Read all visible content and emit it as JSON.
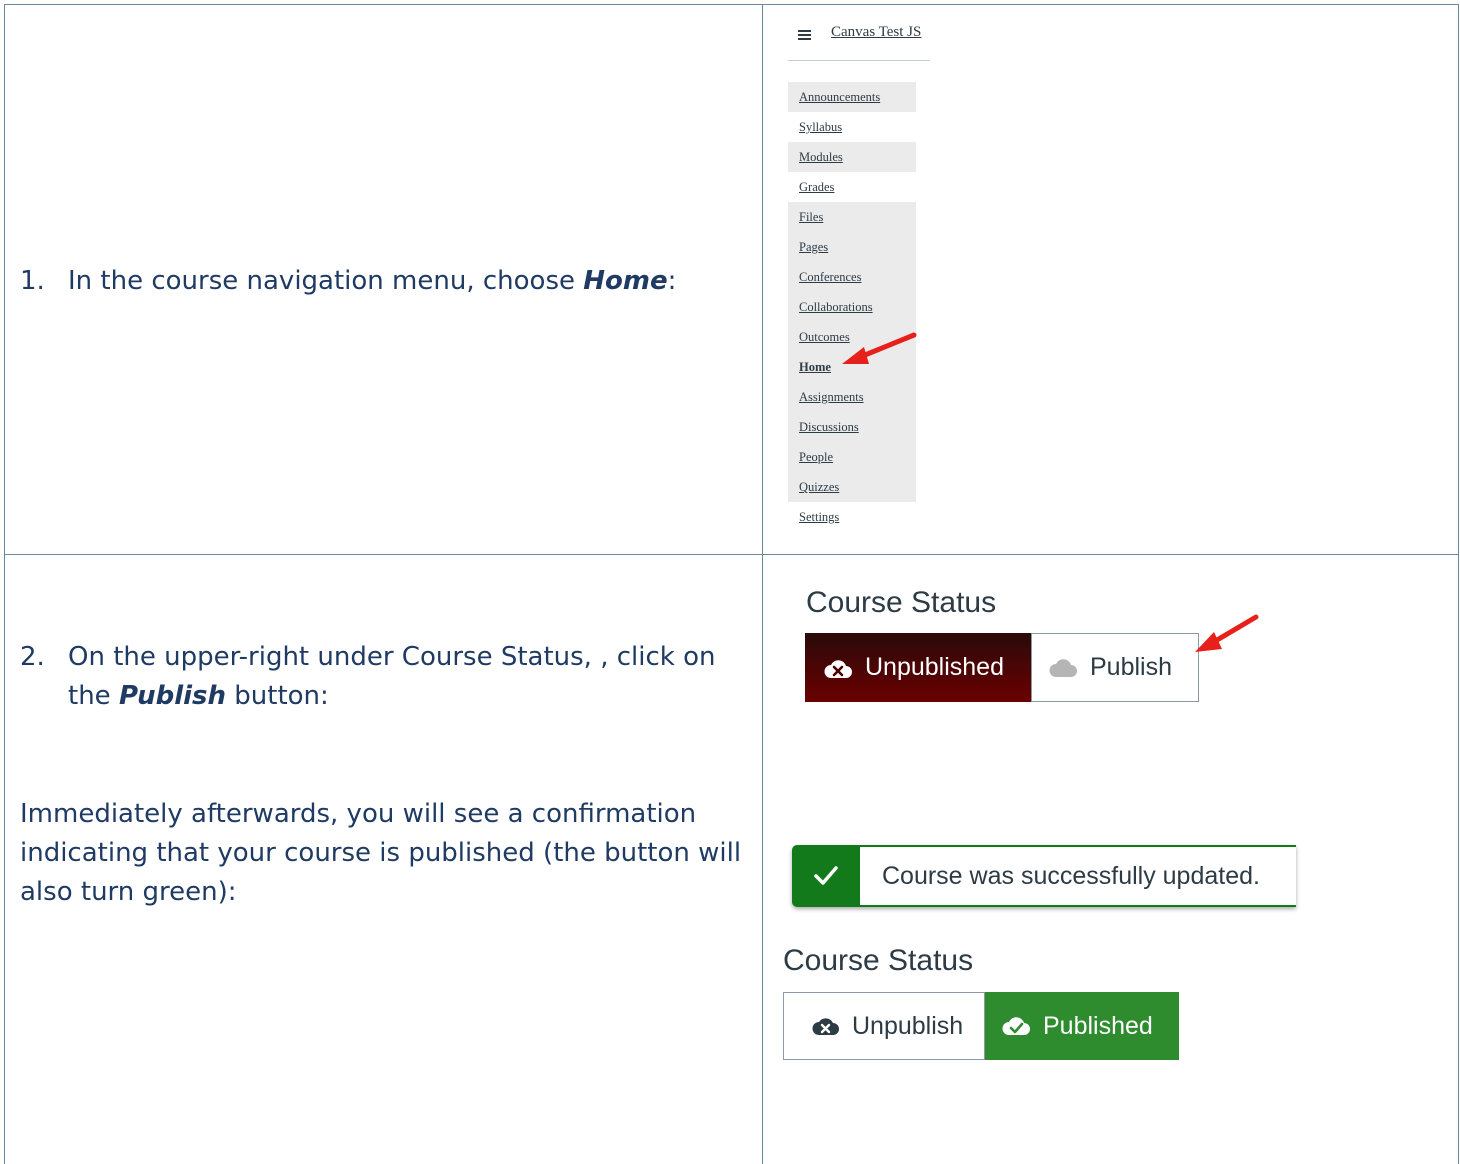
{
  "step1": {
    "number": "1.",
    "text_before": "In the course navigation menu, choose ",
    "emphasis": "Home",
    "text_after": ":"
  },
  "step2": {
    "number": "2.",
    "line1": "On the upper-right under Course Status, , click on",
    "line2_before": "the ",
    "line2_emphasis": "Publish",
    "line2_after": " button:"
  },
  "confirmation_text": {
    "line1": "Immediately afterwards, you will see a confirmation",
    "line2": "indicating that your course is published (the button will",
    "line3": "also turn green):"
  },
  "nav_screenshot": {
    "course_title": "Canvas Test JS",
    "items": [
      {
        "label": "Announcements",
        "shaded": true
      },
      {
        "label": "Syllabus",
        "shaded": false
      },
      {
        "label": "Modules",
        "shaded": true
      },
      {
        "label": "Grades",
        "shaded": false
      },
      {
        "label": "Files",
        "shaded": true
      },
      {
        "label": "Pages",
        "shaded": true
      },
      {
        "label": "Conferences",
        "shaded": true
      },
      {
        "label": "Collaborations",
        "shaded": true
      },
      {
        "label": "Outcomes",
        "shaded": true
      },
      {
        "label": "Home",
        "shaded": true,
        "active": true
      },
      {
        "label": "Assignments",
        "shaded": true
      },
      {
        "label": "Discussions",
        "shaded": true
      },
      {
        "label": "People",
        "shaded": true
      },
      {
        "label": "Quizzes",
        "shaded": true
      },
      {
        "label": "Settings",
        "shaded": false
      }
    ]
  },
  "status_before": {
    "title": "Course Status",
    "unpublished_label": "Unpublished",
    "publish_label": "Publish"
  },
  "flash": {
    "message": "Course was successfully updated."
  },
  "status_after": {
    "title": "Course Status",
    "unpublish_label": "Unpublish",
    "published_label": "Published"
  },
  "colors": {
    "text_blue": "#1f3b64",
    "unpublished_dark": "#4a0000",
    "published_green": "#2e8b2e",
    "flash_green": "#127a1b",
    "arrow_red": "#e8201c"
  }
}
